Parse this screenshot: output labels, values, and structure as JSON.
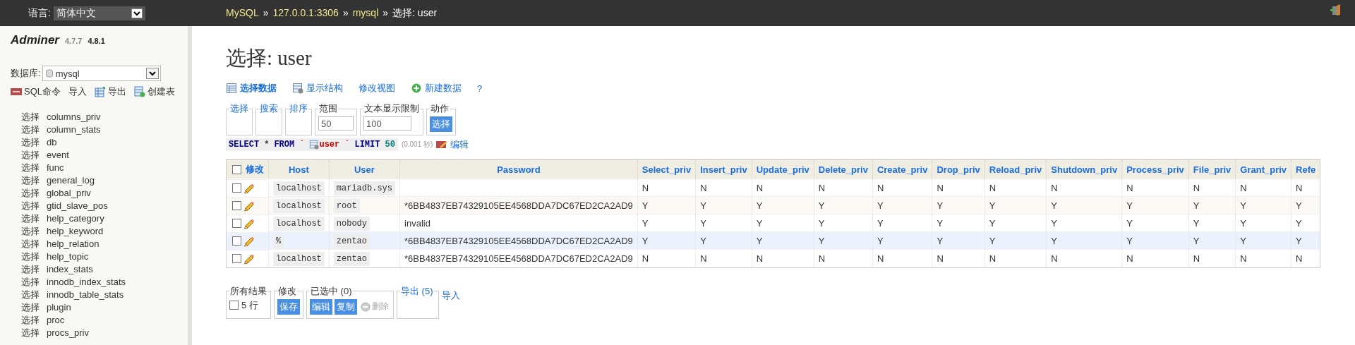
{
  "top_bar": {
    "language_label": "语言:",
    "language": "简体中文",
    "breadcrumb": [
      {
        "text": "MySQL",
        "link": true
      },
      {
        "text": "»",
        "link": false
      },
      {
        "text": "127.0.0.1:3306",
        "link": true
      },
      {
        "text": "»",
        "link": false
      },
      {
        "text": "mysql",
        "link": true
      },
      {
        "text": "»",
        "link": false
      },
      {
        "text": "选择: user",
        "link": false
      }
    ]
  },
  "sidebar": {
    "app_name": "Adminer",
    "versions": [
      {
        "text": "4.7.7",
        "current": false
      },
      {
        "text": "4.8.1",
        "current": true
      }
    ],
    "database_label": "数据库:",
    "database": "mysql",
    "tools": [
      {
        "label": "SQL命令"
      },
      {
        "label": "导入"
      },
      {
        "label": "导出"
      },
      {
        "label": "创建表"
      }
    ],
    "tables": [
      {
        "action": "选择",
        "name": "columns_priv"
      },
      {
        "action": "选择",
        "name": "column_stats"
      },
      {
        "action": "选择",
        "name": "db"
      },
      {
        "action": "选择",
        "name": "event"
      },
      {
        "action": "选择",
        "name": "func"
      },
      {
        "action": "选择",
        "name": "general_log"
      },
      {
        "action": "选择",
        "name": "global_priv"
      },
      {
        "action": "选择",
        "name": "gtid_slave_pos"
      },
      {
        "action": "选择",
        "name": "help_category"
      },
      {
        "action": "选择",
        "name": "help_keyword"
      },
      {
        "action": "选择",
        "name": "help_relation"
      },
      {
        "action": "选择",
        "name": "help_topic"
      },
      {
        "action": "选择",
        "name": "index_stats"
      },
      {
        "action": "选择",
        "name": "innodb_index_stats"
      },
      {
        "action": "选择",
        "name": "innodb_table_stats"
      },
      {
        "action": "选择",
        "name": "plugin"
      },
      {
        "action": "选择",
        "name": "proc"
      },
      {
        "action": "选择",
        "name": "procs_priv"
      }
    ]
  },
  "main": {
    "title": "选择: user",
    "links": [
      {
        "label": "选择数据",
        "selected": true
      },
      {
        "label": "显示结构",
        "selected": false
      },
      {
        "label": "修改视图",
        "selected": false
      },
      {
        "label": "新建数据",
        "selected": false
      },
      {
        "label": "?",
        "selected": false
      }
    ],
    "filters": [
      {
        "legend": "选择",
        "kind": "link"
      },
      {
        "legend": "搜索",
        "kind": "link"
      },
      {
        "legend": "排序",
        "kind": "link"
      },
      {
        "legend": "范围",
        "kind": "input",
        "value": "50"
      },
      {
        "legend": "文本显示限制",
        "kind": "input",
        "value": "100"
      },
      {
        "legend": "动作",
        "kind": "button",
        "button": "选择"
      }
    ],
    "query": {
      "tokens": [
        {
          "text": "SELECT",
          "kind": "keyword"
        },
        {
          "text": "*",
          "kind": "op"
        },
        {
          "text": "FROM",
          "kind": "keyword"
        },
        {
          "text": "`",
          "kind": "ident"
        },
        {
          "text": "user",
          "kind": "table"
        },
        {
          "text": "`",
          "kind": "ident"
        },
        {
          "text": "LIMIT",
          "kind": "keyword"
        },
        {
          "text": "50",
          "kind": "number"
        }
      ],
      "timing": "(0.001 秒)",
      "edit": "编辑"
    },
    "table": {
      "edit_header": "修改",
      "all_checked": false,
      "columns": [
        {
          "label": "Host",
          "kind": "code"
        },
        {
          "label": "User",
          "kind": "code"
        },
        {
          "label": "Password",
          "kind": "text"
        },
        {
          "label": "Select_priv",
          "kind": "text"
        },
        {
          "label": "Insert_priv",
          "kind": "text"
        },
        {
          "label": "Update_priv",
          "kind": "text"
        },
        {
          "label": "Delete_priv",
          "kind": "text"
        },
        {
          "label": "Create_priv",
          "kind": "text"
        },
        {
          "label": "Drop_priv",
          "kind": "text"
        },
        {
          "label": "Reload_priv",
          "kind": "text"
        },
        {
          "label": "Shutdown_priv",
          "kind": "text"
        },
        {
          "label": "Process_priv",
          "kind": "text"
        },
        {
          "label": "File_priv",
          "kind": "text"
        },
        {
          "label": "Grant_priv",
          "kind": "text"
        },
        {
          "label": "Refe",
          "kind": "text"
        }
      ],
      "rows": [
        {
          "checked": false,
          "hovered": false,
          "cells": [
            "localhost",
            "mariadb.sys",
            "",
            "N",
            "N",
            "N",
            "N",
            "N",
            "N",
            "N",
            "N",
            "N",
            "N",
            "N",
            "N"
          ]
        },
        {
          "checked": false,
          "hovered": false,
          "cells": [
            "localhost",
            "root",
            "*6BB4837EB74329105EE4568DDA7DC67ED2CA2AD9",
            "Y",
            "Y",
            "Y",
            "Y",
            "Y",
            "Y",
            "Y",
            "Y",
            "Y",
            "Y",
            "Y",
            "Y"
          ]
        },
        {
          "checked": false,
          "hovered": false,
          "cells": [
            "localhost",
            "nobody",
            "invalid",
            "Y",
            "Y",
            "Y",
            "Y",
            "Y",
            "Y",
            "Y",
            "Y",
            "Y",
            "Y",
            "Y",
            "Y"
          ]
        },
        {
          "checked": false,
          "hovered": true,
          "cells": [
            "%",
            "zentao",
            "*6BB4837EB74329105EE4568DDA7DC67ED2CA2AD9",
            "Y",
            "Y",
            "Y",
            "Y",
            "Y",
            "Y",
            "Y",
            "Y",
            "Y",
            "Y",
            "Y",
            "Y"
          ]
        },
        {
          "checked": false,
          "hovered": false,
          "cells": [
            "localhost",
            "zentao",
            "*6BB4837EB74329105EE4568DDA7DC67ED2CA2AD9",
            "N",
            "N",
            "N",
            "N",
            "N",
            "N",
            "N",
            "N",
            "N",
            "N",
            "N",
            "N"
          ]
        }
      ]
    },
    "bottom": [
      {
        "legend": "所有结果",
        "kind": "checkbox",
        "label": "5 行",
        "checked": false
      },
      {
        "legend": "修改",
        "kind": "buttons",
        "buttons": [
          {
            "label": "保存",
            "disabled": false
          }
        ]
      },
      {
        "legend": "已选中 (0)",
        "kind": "buttons",
        "buttons": [
          {
            "label": "编辑",
            "disabled": false
          },
          {
            "label": "复制",
            "disabled": false
          },
          {
            "label": "删除",
            "disabled": true
          }
        ]
      },
      {
        "legend": "导出 (5)",
        "kind": "link"
      }
    ],
    "import_link": "导入"
  }
}
